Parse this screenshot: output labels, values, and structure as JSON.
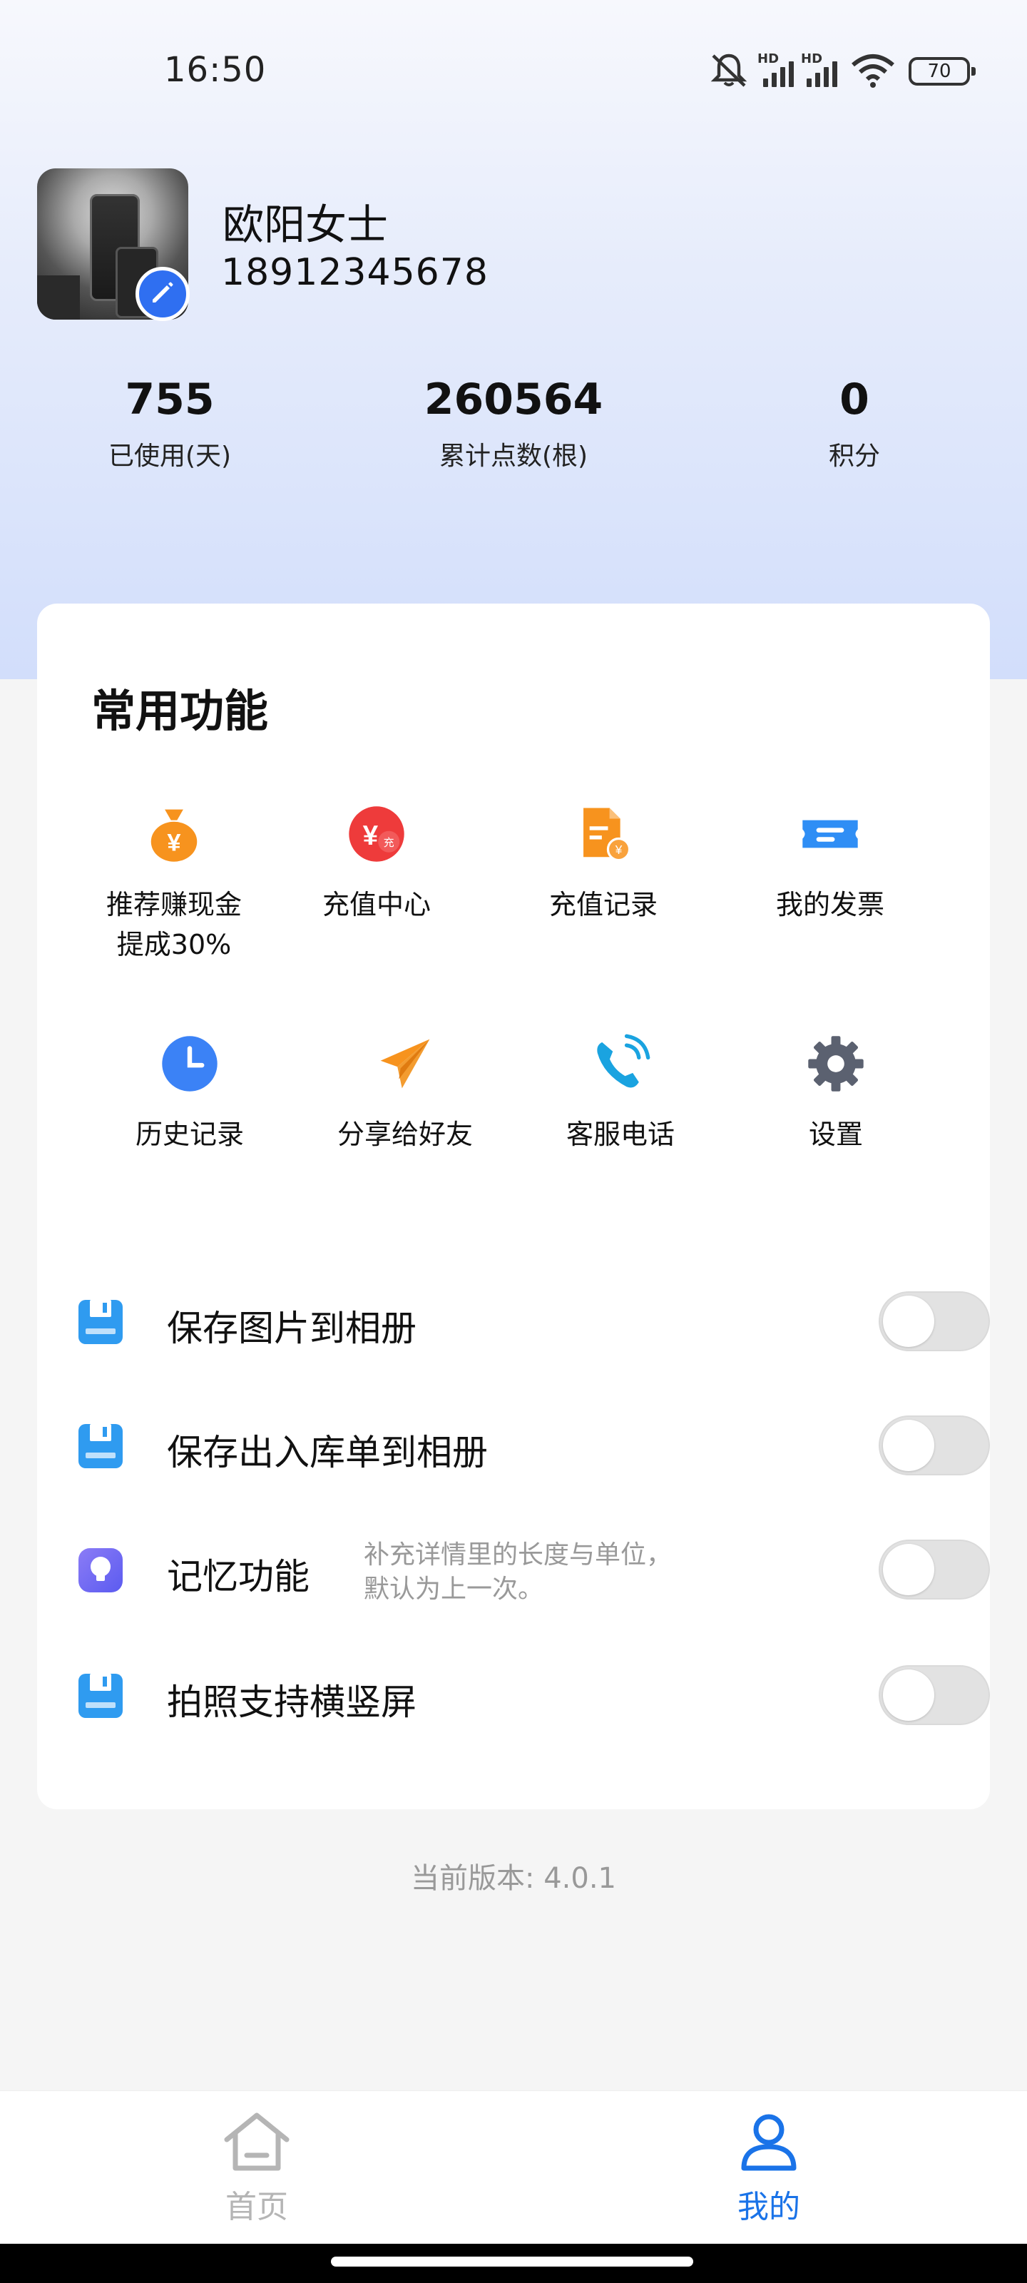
{
  "status_bar": {
    "time": "16:50",
    "battery": "70",
    "hd_label": "HD",
    "icons": [
      "bell-muted-icon",
      "signal-hd-icon",
      "signal-hd-icon",
      "wifi-icon",
      "battery-icon"
    ]
  },
  "profile": {
    "name": "欧阳女士",
    "phone": "18912345678"
  },
  "stats": [
    {
      "value": "755",
      "label": "已使用(天)"
    },
    {
      "value": "260564",
      "label": "累计点数(根)"
    },
    {
      "value": "0",
      "label": "积分"
    }
  ],
  "functions": {
    "title": "常用功能",
    "items": [
      {
        "label_line1": "推荐赚现金",
        "label_line2": "提成30%",
        "icon": "money-bag-icon",
        "color": "#f7931e"
      },
      {
        "label_line1": "充值中心",
        "label_line2": "",
        "icon": "recharge-yen-icon",
        "color": "#ee3b3b"
      },
      {
        "label_line1": "充值记录",
        "label_line2": "",
        "icon": "record-document-icon",
        "color": "#f7931e"
      },
      {
        "label_line1": "我的发票",
        "label_line2": "",
        "icon": "invoice-ticket-icon",
        "color": "#2f8ef5"
      },
      {
        "label_line1": "历史记录",
        "label_line2": "",
        "icon": "clock-icon",
        "color": "#3b82f6"
      },
      {
        "label_line1": "分享给好友",
        "label_line2": "",
        "icon": "paper-plane-icon",
        "color": "#f7931e"
      },
      {
        "label_line1": "客服电话",
        "label_line2": "",
        "icon": "phone-icon",
        "color": "#1aa3e0"
      },
      {
        "label_line1": "设置",
        "label_line2": "",
        "icon": "gear-icon",
        "color": "#5b6170"
      }
    ]
  },
  "settings": [
    {
      "label": "保存图片到相册",
      "hint_line1": "",
      "hint_line2": "",
      "enabled": false,
      "icon": "save-disk-icon"
    },
    {
      "label": "保存出入库单到相册",
      "hint_line1": "",
      "hint_line2": "",
      "enabled": false,
      "icon": "save-disk-icon"
    },
    {
      "label": "记忆功能",
      "hint_line1": "补充详情里的长度与单位，",
      "hint_line2": "默认为上一次。",
      "enabled": false,
      "icon": "lightbulb-icon"
    },
    {
      "label": "拍照支持横竖屏",
      "hint_line1": "",
      "hint_line2": "",
      "enabled": false,
      "icon": "save-disk-icon"
    }
  ],
  "version": "当前版本: 4.0.1",
  "nav": {
    "home_label": "首页",
    "mine_label": "我的",
    "active": "mine",
    "active_color": "#1a73e8",
    "inactive_color": "#b5b5b5"
  }
}
